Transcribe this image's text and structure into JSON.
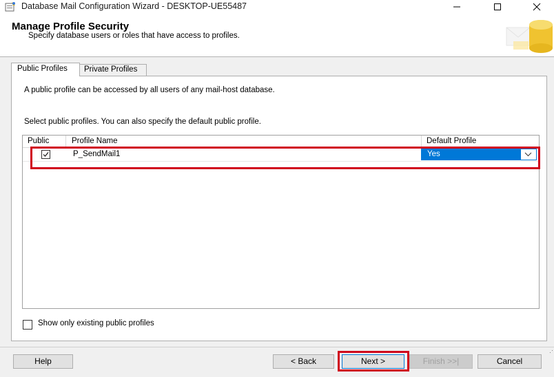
{
  "window": {
    "title": "Database Mail Configuration Wizard - DESKTOP-UE55487"
  },
  "header": {
    "title": "Manage Profile Security",
    "subtitle": "Specify database users or roles that have access to profiles."
  },
  "tabs": [
    {
      "label": "Public Profiles",
      "selected": true
    },
    {
      "label": "Private Profiles",
      "selected": false
    }
  ],
  "panel": {
    "description": "A public profile can be accessed by all users of any mail-host database.",
    "instruction": "Select public profiles. You can also specify the default public profile."
  },
  "grid": {
    "columns": [
      "Public",
      "Profile Name",
      "Default Profile"
    ],
    "rows": [
      {
        "public": true,
        "profile_name": "P_SendMail1",
        "default_profile": "Yes"
      }
    ]
  },
  "options": {
    "show_existing_label": "Show only existing public profiles",
    "show_existing_checked": false
  },
  "buttons": {
    "help": "Help",
    "back": "< Back",
    "next": "Next >",
    "finish": "Finish >>|",
    "cancel": "Cancel"
  },
  "colors": {
    "highlight": "#d0021b",
    "selection": "#0078d7"
  }
}
